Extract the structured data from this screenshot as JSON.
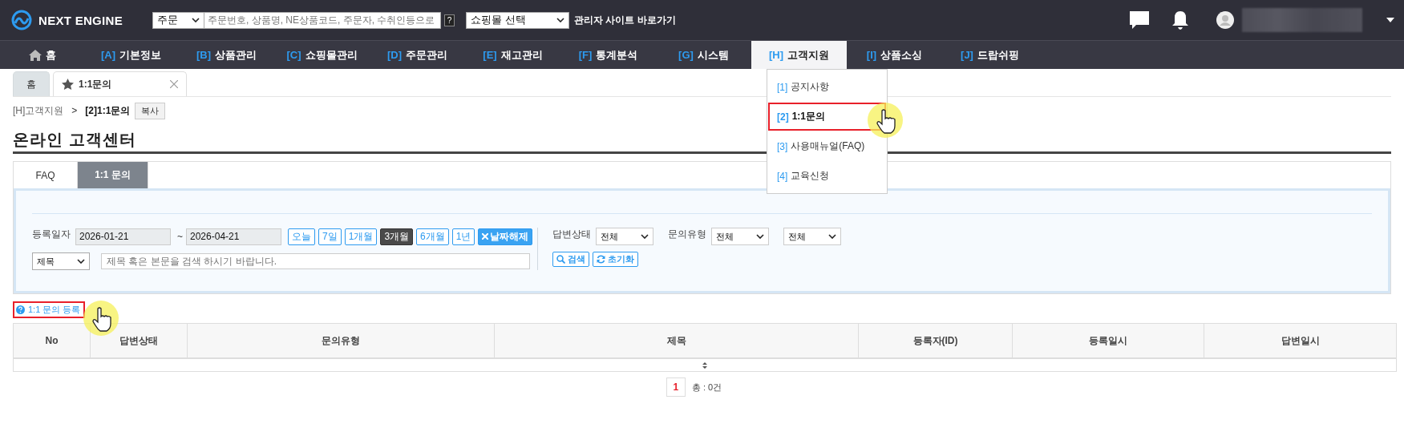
{
  "header": {
    "logo": "NEXT ENGINE",
    "search_scope": "주문",
    "search": {
      "placeholder": "주문번호, 상품명, NE상품코드, 주문자, 수취인등으로"
    },
    "help": "?",
    "shop_select": "쇼핑몰 선택",
    "admin_link": "관리자 사이트 바로가기"
  },
  "nav": [
    {
      "kind": "home",
      "label": "홈",
      "selected": false
    },
    {
      "kind": "menu",
      "prefix": "[A]",
      "label": "기본정보",
      "selected": false
    },
    {
      "kind": "menu",
      "prefix": "[B]",
      "label": "상품관리",
      "selected": false
    },
    {
      "kind": "menu",
      "prefix": "[C]",
      "label": "쇼핑몰관리",
      "selected": false
    },
    {
      "kind": "menu",
      "prefix": "[D]",
      "label": "주문관리",
      "selected": false
    },
    {
      "kind": "menu",
      "prefix": "[E]",
      "label": "재고관리",
      "selected": false
    },
    {
      "kind": "menu",
      "prefix": "[F]",
      "label": "통계분석",
      "selected": false
    },
    {
      "kind": "menu",
      "prefix": "[G]",
      "label": "시스템",
      "selected": false
    },
    {
      "kind": "menu",
      "prefix": "[H]",
      "label": "고객지원",
      "selected": true,
      "submenu": [
        {
          "prefix": "[1]",
          "label": "공지사항",
          "selected": false,
          "highlighted": false
        },
        {
          "prefix": "[2]",
          "label": "1:1문의",
          "selected": true,
          "highlighted": true
        },
        {
          "prefix": "[3]",
          "label": "사용매뉴얼(FAQ)",
          "selected": false,
          "highlighted": false
        },
        {
          "prefix": "[4]",
          "label": "교육신청",
          "selected": false,
          "highlighted": false
        }
      ]
    },
    {
      "kind": "menu",
      "prefix": "[I]",
      "label": "상품소싱",
      "selected": false
    },
    {
      "kind": "menu",
      "prefix": "[J]",
      "label": "드랍쉬핑",
      "selected": false
    }
  ],
  "page_tabs": [
    {
      "kind": "home",
      "label": "홈",
      "selected": false
    },
    {
      "kind": "page",
      "label": "1:1문의",
      "selected": true
    }
  ],
  "breadcrumb": {
    "parent": "[H]고객지원",
    "separator": ">",
    "current": "[2]1:1문의",
    "copy_button": "복사"
  },
  "title": "온라인 고객센터",
  "section_tabs": [
    {
      "label": "FAQ",
      "selected": false
    },
    {
      "label": "1:1 문의",
      "selected": true
    }
  ],
  "filters": {
    "date_label": "등록일자",
    "date_from": "2026-01-21",
    "date_sep": "~",
    "date_to": "2026-04-21",
    "ranges": [
      {
        "kind": "range",
        "label": "오늘",
        "selected": false
      },
      {
        "kind": "range",
        "label": "7일",
        "selected": false
      },
      {
        "kind": "range",
        "label": "1개월",
        "selected": false
      },
      {
        "kind": "range",
        "label": "3개월",
        "selected": true
      },
      {
        "kind": "range",
        "label": "6개월",
        "selected": false
      },
      {
        "kind": "range",
        "label": "1년",
        "selected": false
      },
      {
        "kind": "clear",
        "label": "날짜해제",
        "selected": false
      }
    ],
    "keyword_field": "제목",
    "keyword": {
      "placeholder": "제목 혹은 본문을 검색 하시기 바랍니다."
    },
    "selects": [
      {
        "label": "답변상태",
        "value": "전체"
      },
      {
        "label": "문의유형",
        "value": "전체"
      },
      {
        "value": "전체"
      }
    ],
    "buttons": [
      {
        "kind": "search",
        "label": "검색"
      },
      {
        "kind": "reset",
        "label": "초기화"
      }
    ]
  },
  "register_link": {
    "label": "1:1 문의 등록",
    "highlighted": true
  },
  "table": {
    "columns": [
      "No",
      "답변상태",
      "문의유형",
      "제목",
      "등록자(ID)",
      "등록일시",
      "답변일시"
    ]
  },
  "pagination": {
    "pages": [
      {
        "label": "1",
        "selected": true
      }
    ],
    "total": "총 : 0건"
  }
}
